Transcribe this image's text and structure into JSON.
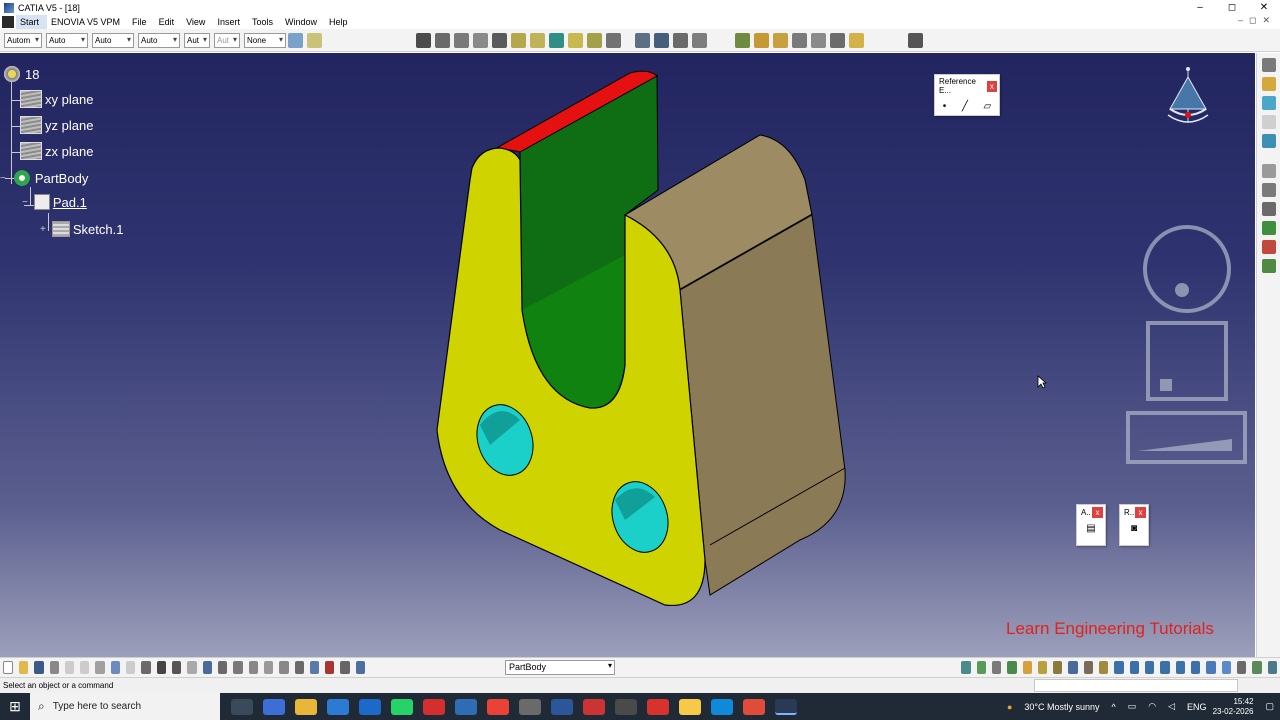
{
  "window": {
    "title": "CATIA V5 - [18]",
    "controls": [
      "–",
      "◻",
      "✕"
    ]
  },
  "menu": {
    "items": [
      "Start",
      "ENOVIA V5 VPM",
      "File",
      "Edit",
      "View",
      "Insert",
      "Tools",
      "Window",
      "Help"
    ]
  },
  "toolbar": {
    "combos": [
      "Autom",
      "Auto",
      "Auto",
      "Auto",
      "Aut",
      "Aut",
      "None"
    ]
  },
  "tree": {
    "root": "18",
    "xy": "xy plane",
    "yz": "yz plane",
    "zx": "zx plane",
    "body": "PartBody",
    "pad": "Pad.1",
    "sketch": "Sketch.1"
  },
  "panels": {
    "reference": {
      "title": "Reference E...",
      "close": "x"
    },
    "a": {
      "title": "A..",
      "close": "x"
    },
    "r": {
      "title": "R..",
      "close": "x"
    }
  },
  "watermark": "Learn Engineering Tutorials",
  "bottom_toolbar": {
    "body_select": "PartBody"
  },
  "status": {
    "message": "Select an object or a command"
  },
  "taskbar": {
    "search_placeholder": "Type here to search",
    "weather": "30°C  Mostly sunny",
    "language": "ENG",
    "time": "15:42",
    "date": "23-02-2026"
  },
  "colors": {
    "face_yellow": "#cfd400",
    "face_green": "#0f6e13",
    "face_red": "#e51010",
    "face_tan": "#8a7a55",
    "hole_cyan": "#1ad0c9",
    "watermark": "#e0231c"
  }
}
